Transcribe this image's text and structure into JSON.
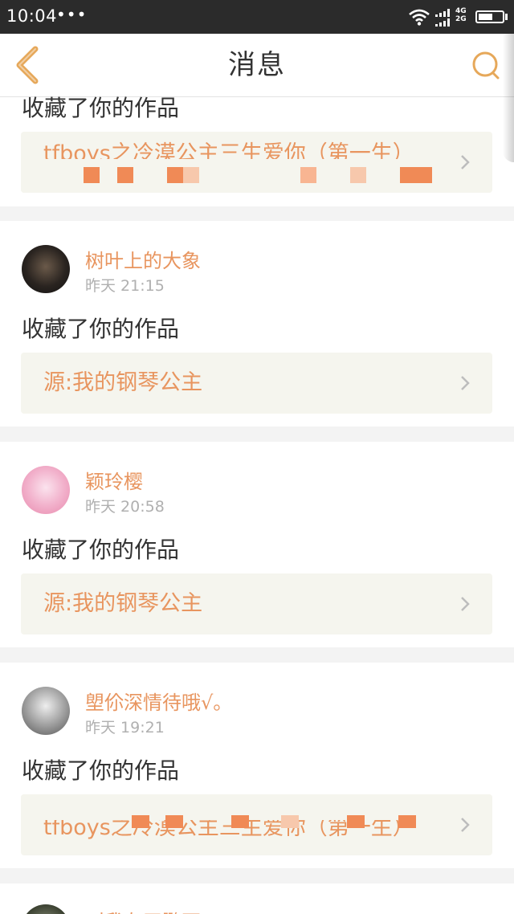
{
  "status_bar": {
    "time": "10:04",
    "dots": "•••",
    "network_top": "4G",
    "network_bottom": "2G",
    "battery_level": 0.6
  },
  "nav": {
    "title": "消息",
    "back_icon": "chevron-left-icon",
    "search_icon": "search-icon"
  },
  "colors": {
    "accent": "#e8955f",
    "nav_icon": "#e6a85a",
    "time_text": "#b0b0b0",
    "body_text": "#333333",
    "work_bg": "#f5f5ee",
    "page_bg": "#f3f3f3"
  },
  "messages": [
    {
      "action": "收藏了你的作品",
      "work_title": "tfboys之冷漠公主三生爱你（第一生）"
    },
    {
      "user": "树叶上的大象",
      "time": "昨天 21:15",
      "action": "收藏了你的作品",
      "work_title": "源:我的钢琴公主"
    },
    {
      "user": "颖玲樱",
      "time": "昨天 20:58",
      "action": "收藏了你的作品",
      "work_title": "源:我的钢琴公主"
    },
    {
      "user": "塱伱深情待哦√。",
      "time": "昨天 19:21",
      "action": "收藏了你的作品",
      "work_title": "tfboys之冷漠公主三生爱你（第一生）"
    },
    {
      "user": "叫我左天鹏丐"
    }
  ]
}
